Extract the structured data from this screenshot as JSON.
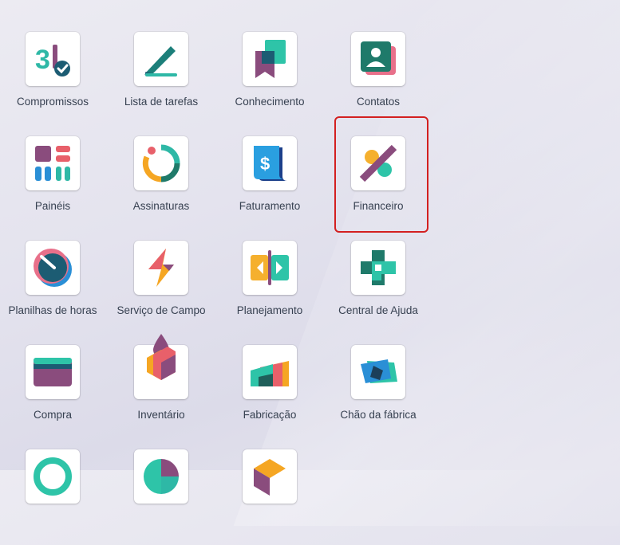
{
  "apps": [
    {
      "label": "Compromissos",
      "icon": "calendar-icon"
    },
    {
      "label": "Lista de tarefas",
      "icon": "todo-pen-icon"
    },
    {
      "label": "Conhecimento",
      "icon": "knowledge-bookmark-icon"
    },
    {
      "label": "Contatos",
      "icon": "contact-card-icon"
    },
    {
      "label": "Painéis",
      "icon": "dashboard-grid-icon"
    },
    {
      "label": "Assinaturas",
      "icon": "subscription-cycle-icon"
    },
    {
      "label": "Faturamento",
      "icon": "invoice-dollar-icon"
    },
    {
      "label": "Financeiro",
      "icon": "percent-icon"
    },
    {
      "label": "Planilhas de horas",
      "icon": "timer-dial-icon"
    },
    {
      "label": "Serviço de Campo",
      "icon": "lightning-icon"
    },
    {
      "label": "Planejamento",
      "icon": "planning-arrows-icon"
    },
    {
      "label": "Central de Ajuda",
      "icon": "helpdesk-cross-icon"
    },
    {
      "label": "Compra",
      "icon": "credit-card-icon"
    },
    {
      "label": "Inventário",
      "icon": "inventory-box-icon"
    },
    {
      "label": "Fabricação",
      "icon": "factory-icon"
    },
    {
      "label": "Chão da fábrica",
      "icon": "shop-floor-icon"
    }
  ],
  "partial_row_icons": [
    "partial-teal-icon",
    "partial-pie-icon",
    "partial-box-icon"
  ],
  "highlighted_app": "Financeiro"
}
